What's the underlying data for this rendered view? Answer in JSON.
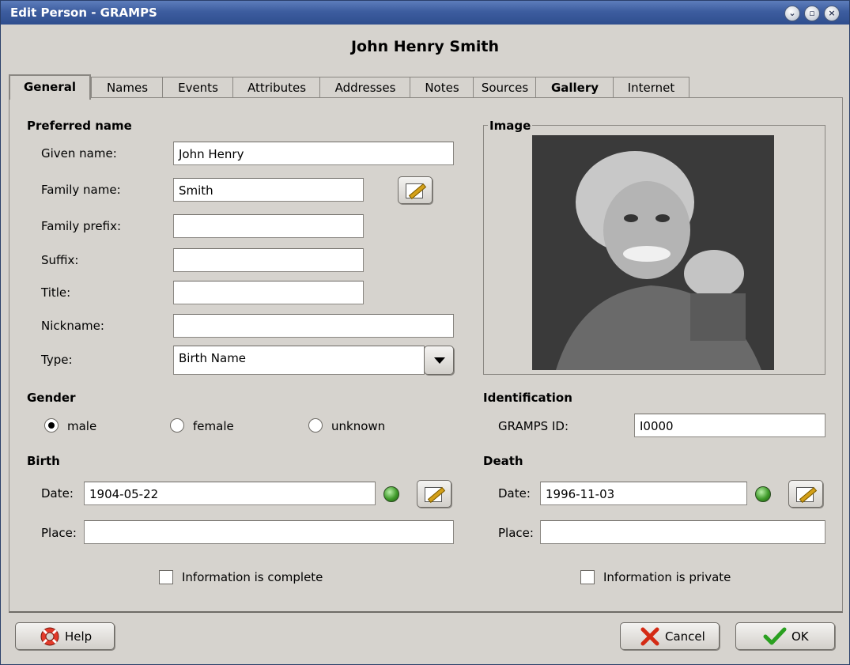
{
  "window": {
    "title": "Edit Person - GRAMPS",
    "controls": [
      "minimize",
      "maximize",
      "close"
    ]
  },
  "person_title": "John Henry Smith",
  "tabs": [
    {
      "label": "General",
      "active": true
    },
    {
      "label": "Names"
    },
    {
      "label": "Events"
    },
    {
      "label": "Attributes"
    },
    {
      "label": "Addresses"
    },
    {
      "label": "Notes"
    },
    {
      "label": "Sources"
    },
    {
      "label": "Gallery",
      "bold": true
    },
    {
      "label": "Internet"
    }
  ],
  "preferred_name": {
    "section": "Preferred name",
    "given_label": "Given name:",
    "given_value": "John Henry",
    "family_label": "Family name:",
    "family_value": "Smith",
    "prefix_label": "Family prefix:",
    "prefix_value": "",
    "suffix_label": "Suffix:",
    "suffix_value": "",
    "title_label": "Title:",
    "title_value": "",
    "nickname_label": "Nickname:",
    "nickname_value": "",
    "type_label": "Type:",
    "type_value": "Birth Name"
  },
  "image": {
    "section": "Image"
  },
  "gender": {
    "section": "Gender",
    "options": [
      "male",
      "female",
      "unknown"
    ],
    "selected": "male"
  },
  "identification": {
    "section": "Identification",
    "id_label": "GRAMPS ID:",
    "id_value": "I0000"
  },
  "birth": {
    "section": "Birth",
    "date_label": "Date:",
    "date_value": "1904-05-22",
    "place_label": "Place:",
    "place_value": "",
    "status_color": "#3f9a2a"
  },
  "death": {
    "section": "Death",
    "date_label": "Date:",
    "date_value": "1996-11-03",
    "place_label": "Place:",
    "place_value": "",
    "status_color": "#3f9a2a"
  },
  "checks": {
    "complete_label": "Information is complete",
    "complete_checked": false,
    "private_label": "Information is private",
    "private_checked": false
  },
  "buttons": {
    "help": "Help",
    "cancel": "Cancel",
    "ok": "OK"
  },
  "icons": {
    "help": "lifebuoy-icon",
    "cancel": "red-x-icon",
    "ok": "green-check-icon",
    "edit": "edit-pencil-icon"
  }
}
